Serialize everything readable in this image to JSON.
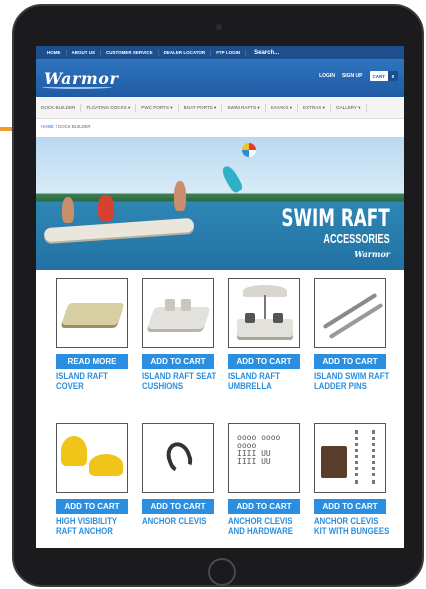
{
  "topnav": {
    "links": [
      "HOME",
      "ABOUT US",
      "CUSTOMER SERVICE",
      "DEALER LOCATOR",
      "FTP LOGIN"
    ],
    "search_label": "Search..."
  },
  "header": {
    "logo_text": "Warmor",
    "login": "LOGIN",
    "signup": "SIGN UP",
    "cart_label": "CART",
    "cart_count": "0"
  },
  "mainnav": {
    "items": [
      "DOCK BUILDER",
      "FLOATING DOCKS ▾",
      "PWC PORTS ▾",
      "BOAT PORTS ▾",
      "SWIM RAFTS ▾",
      "KAYAKS ▾",
      "EXTRAS ▾",
      "GALLERY ▾"
    ]
  },
  "breadcrumb": {
    "home": "HOME",
    "current": "\\ DOCK BUILDER"
  },
  "banner": {
    "title": "SWIM RAFT",
    "subtitle": "ACCESSORIES",
    "logo": "Warmor"
  },
  "products": [
    {
      "button": "READ MORE",
      "name": "ISLAND RAFT COVER"
    },
    {
      "button": "ADD TO CART",
      "name": "ISLAND RAFT SEAT CUSHIONS"
    },
    {
      "button": "ADD TO CART",
      "name": "ISLAND RAFT UMBRELLA"
    },
    {
      "button": "ADD TO CART",
      "name": "ISLAND SWIM RAFT LADDER PINS"
    },
    {
      "button": "ADD TO CART",
      "name": "HIGH VISIBILITY RAFT ANCHOR"
    },
    {
      "button": "ADD TO CART",
      "name": "ANCHOR CLEVIS"
    },
    {
      "button": "ADD TO CART",
      "name": "ANCHOR CLEVIS AND HARDWARE"
    },
    {
      "button": "ADD TO CART",
      "name": "ANCHOR CLEVIS KIT WITH BUNGEES"
    }
  ],
  "colors": {
    "brand_blue": "#1f5ba3",
    "button_blue": "#2a8fe0",
    "accent_orange": "#f29a2e"
  }
}
